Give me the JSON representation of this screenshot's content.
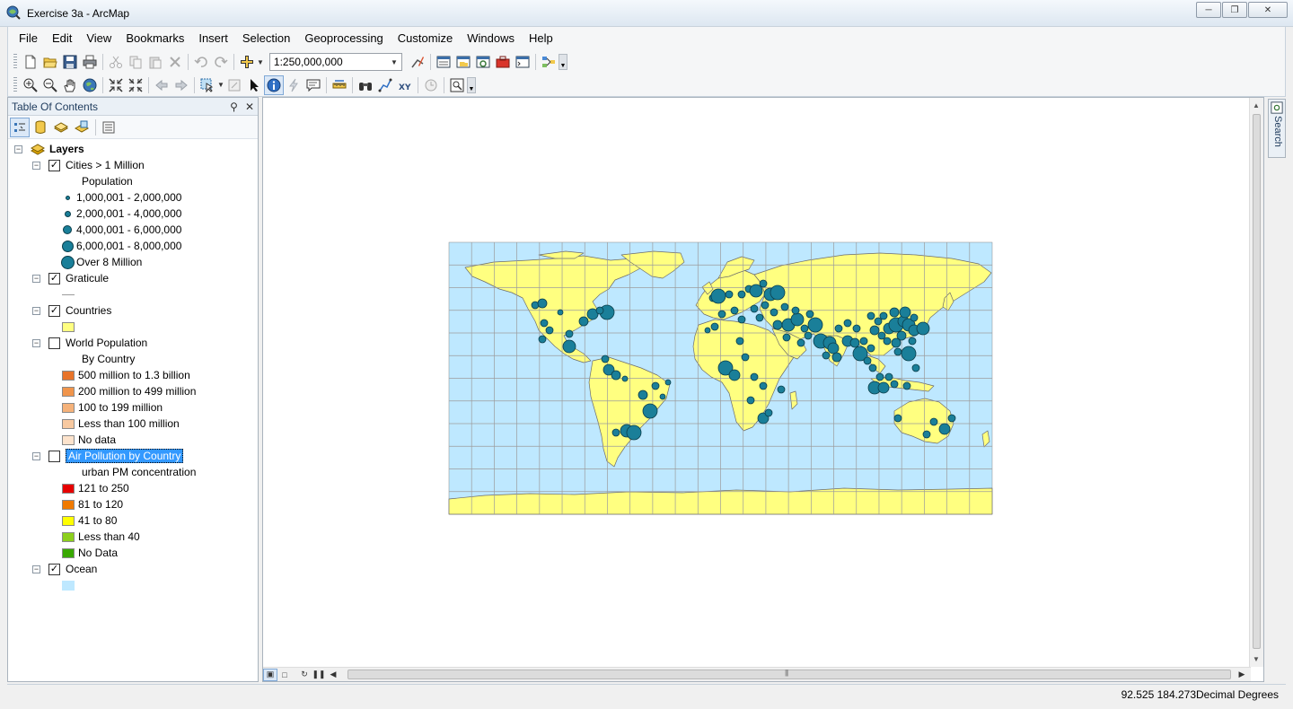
{
  "window": {
    "title": "Exercise 3a - ArcMap"
  },
  "menu": [
    "File",
    "Edit",
    "View",
    "Bookmarks",
    "Insert",
    "Selection",
    "Geoprocessing",
    "Customize",
    "Windows",
    "Help"
  ],
  "toolbar": {
    "scale": "1:250,000,000"
  },
  "toc": {
    "title": "Table Of Contents",
    "root": "Layers",
    "cities": {
      "name": "Cities > 1 Million",
      "checked": true,
      "field": "Population",
      "classes": [
        "1,000,001 - 2,000,000",
        "2,000,001 - 4,000,000",
        "4,000,001 - 6,000,000",
        "6,000,001 - 8,000,000",
        "Over 8 Million"
      ]
    },
    "graticule": {
      "name": "Graticule",
      "checked": true
    },
    "countries": {
      "name": "Countries",
      "checked": true,
      "color": "#ffff80"
    },
    "world_population": {
      "name": "World Population",
      "checked": false,
      "field": "By Country",
      "classes": [
        "500 million to 1.3 billion",
        "200 million to 499 million",
        "100 to 199 million",
        "Less than 100 million",
        "No data"
      ],
      "colors": [
        "#e8742a",
        "#f0954c",
        "#f5b27a",
        "#f8c9a0",
        "#fde3cc"
      ]
    },
    "air_pollution": {
      "name": "Air Pollution by Country",
      "checked": false,
      "field": "urban PM concentration",
      "classes": [
        "121 to 250",
        "81 to 120",
        "41 to 80",
        "Less than 40",
        "No Data"
      ],
      "colors": [
        "#e60000",
        "#f07a00",
        "#ffff00",
        "#8ccf1c",
        "#38a800"
      ]
    },
    "ocean": {
      "name": "Ocean",
      "checked": true,
      "color": "#bee8ff"
    }
  },
  "map": {
    "land_color": "#ffff80",
    "ocean_color": "#bee8ff",
    "city_color": "#1a7f99",
    "grid_color": "#9c9c9c"
  },
  "side_panel": {
    "label": "Search"
  },
  "status": {
    "coords": "92.525  184.273",
    "units": "Decimal Degrees"
  }
}
